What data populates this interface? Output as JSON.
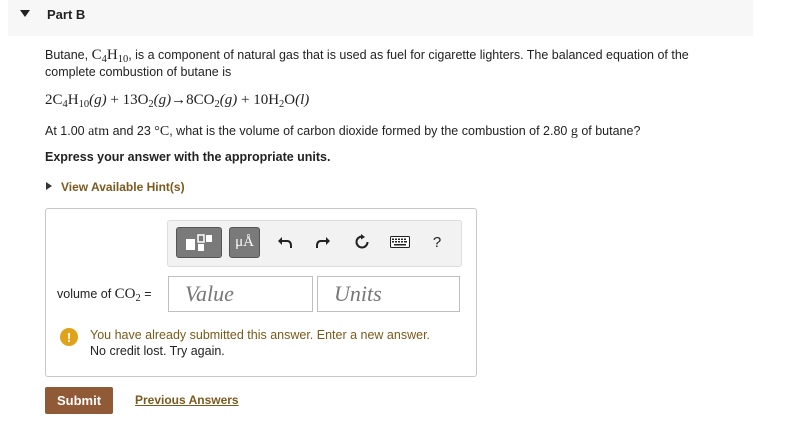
{
  "part": {
    "title": "Part B"
  },
  "problem": {
    "text_1": "Butane, ",
    "formula_c": "C",
    "formula_c_sub": "4",
    "formula_h": "H",
    "formula_h_sub": "10",
    "text_2": ", is a component of natural gas that is used as fuel for cigarette lighters. The balanced equation of the complete combustion of butane is"
  },
  "equation": {
    "coef_1": "2C",
    "s1": "4",
    "h1": "H",
    "s2": "10",
    "st1": "(g)",
    "plus_1": " + 13O",
    "s3": "2",
    "st2": "(g)",
    "arrow": "→",
    "co2": "8CO",
    "s4": "2",
    "st3": "(g)",
    "plus_2": " + 10H",
    "s5": "2",
    "o": "O",
    "st4": "(l)"
  },
  "question": {
    "pre": "At 1.00 ",
    "unit_atm": "atm",
    "mid_1": " and 23 ",
    "unit_deg": "°C",
    "mid_2": ", what is the volume of carbon dioxide formed by the combustion of 2.80 ",
    "unit_g": "g",
    "post": " of butane?"
  },
  "instruction": "Express your answer with the appropriate units.",
  "hint": {
    "label": "View Available Hint(s)"
  },
  "toolbar": {
    "units_label": "μÅ",
    "help_label": "?",
    "icons": [
      "templates-icon",
      "units-icon",
      "undo-icon",
      "redo-icon",
      "reset-icon",
      "keyboard-icon",
      "help-icon"
    ]
  },
  "field": {
    "label_pre": "volume of ",
    "label_co": "CO",
    "label_sub": "2",
    "label_post": " =",
    "value_placeholder": "Value",
    "units_placeholder": "Units"
  },
  "feedback": {
    "icon": "!",
    "line_1": "You have already submitted this answer. Enter a new answer.",
    "line_2": "No credit lost. Try again."
  },
  "actions": {
    "submit_label": "Submit",
    "previous_label": "Previous Answers"
  },
  "colors": {
    "accent_brown": "#8f5a35",
    "link_brown": "#7b5a1f",
    "warning": "#e0a21b"
  }
}
